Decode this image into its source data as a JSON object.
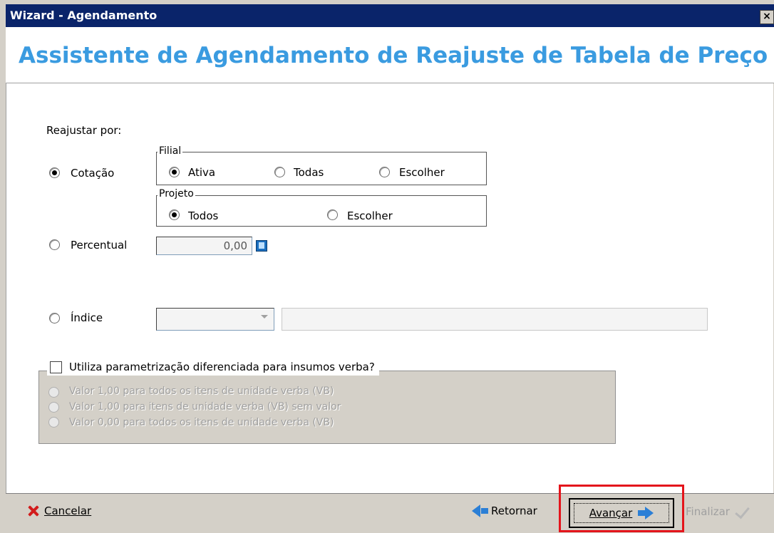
{
  "window": {
    "title": "Wizard - Agendamento",
    "close_label": "×"
  },
  "header": {
    "title": "Assistente de Agendamento de Reajuste de Tabela de Preço"
  },
  "form": {
    "reajustar_label": "Reajustar por:",
    "cotacao": {
      "label": "Cotação",
      "selected": true
    },
    "filial": {
      "legend": "Filial",
      "options": [
        "Ativa",
        "Todas",
        "Escolher"
      ],
      "selected": "Ativa"
    },
    "projeto": {
      "legend": "Projeto",
      "options": [
        "Todos",
        "Escolher"
      ],
      "selected": "Todos"
    },
    "percentual": {
      "label": "Percentual",
      "value": "0,00",
      "selected": false
    },
    "indice": {
      "label": "Índice",
      "selected": false,
      "combo_value": "",
      "text_value": ""
    }
  },
  "insumos": {
    "checkbox_label": "Utiliza parametrização diferenciada para insumos verba?",
    "checked": false,
    "options": [
      "Valor 1,00 para todos os itens de unidade verba (VB)",
      "Valor 1,00 para itens de unidade verba (VB) sem valor",
      "Valor 0,00 para todos os itens de unidade verba (VB)"
    ]
  },
  "footer": {
    "cancelar": "Cancelar",
    "retornar": "Retornar",
    "avancar": "Avançar",
    "finalizar": "Finalizar"
  },
  "colors": {
    "title_blue": "#3a9be0",
    "titlebar": "#0a246a",
    "highlight": "#e4141b"
  }
}
